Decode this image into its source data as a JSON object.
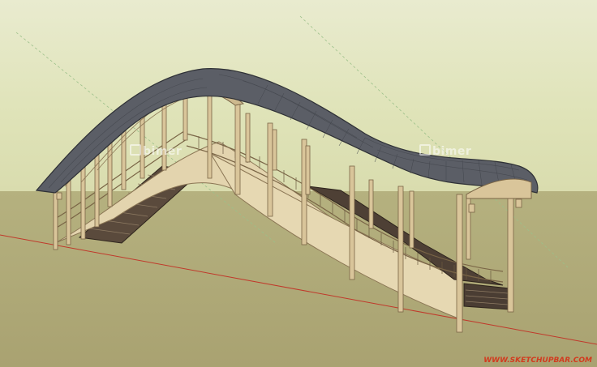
{
  "watermarks": {
    "left": "bimer",
    "right": "bimer"
  },
  "footer": {
    "site": "WWW.SKETCHUPBAR.COM"
  },
  "colors": {
    "sky": "#e3e6c2",
    "ground": "#aea775",
    "roof": "#5b5e66",
    "roof_edge": "#3d3f44",
    "timber": "#d9c59a",
    "timber_dark": "#8a7554",
    "stair": "#5a4a3c",
    "axis_red": "#c0392b"
  },
  "icons": {
    "watermark": "bimer-logo-icon"
  }
}
